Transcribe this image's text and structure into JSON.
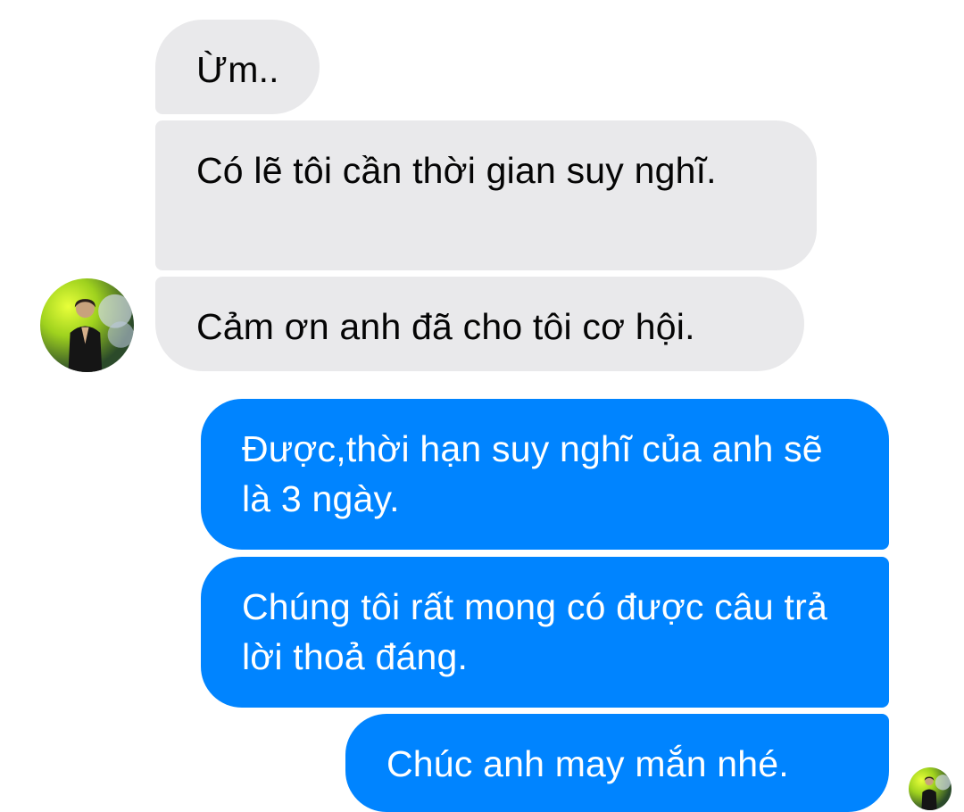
{
  "conversation": {
    "incoming": [
      {
        "text": "Ừm.."
      },
      {
        "text": "Có lẽ tôi cần thời gian suy nghĩ."
      },
      {
        "text": "Cảm ơn anh đã cho tôi cơ hội."
      }
    ],
    "outgoing": [
      {
        "text": "Được,thời hạn suy nghĩ của anh sẽ là 3 ngày."
      },
      {
        "text": "Chúng tôi rất mong có được câu trả lời thoả đáng."
      },
      {
        "text": "Chúc anh may mắn nhé."
      }
    ]
  },
  "colors": {
    "incoming_bubble": "#e9e9eb",
    "outgoing_bubble": "#0084ff",
    "incoming_text": "#050505",
    "outgoing_text": "#ffffff",
    "background": "#ffffff"
  },
  "icons": {
    "contact_avatar": "contact-avatar-photo",
    "seen_indicator": "seen-avatar-photo"
  }
}
